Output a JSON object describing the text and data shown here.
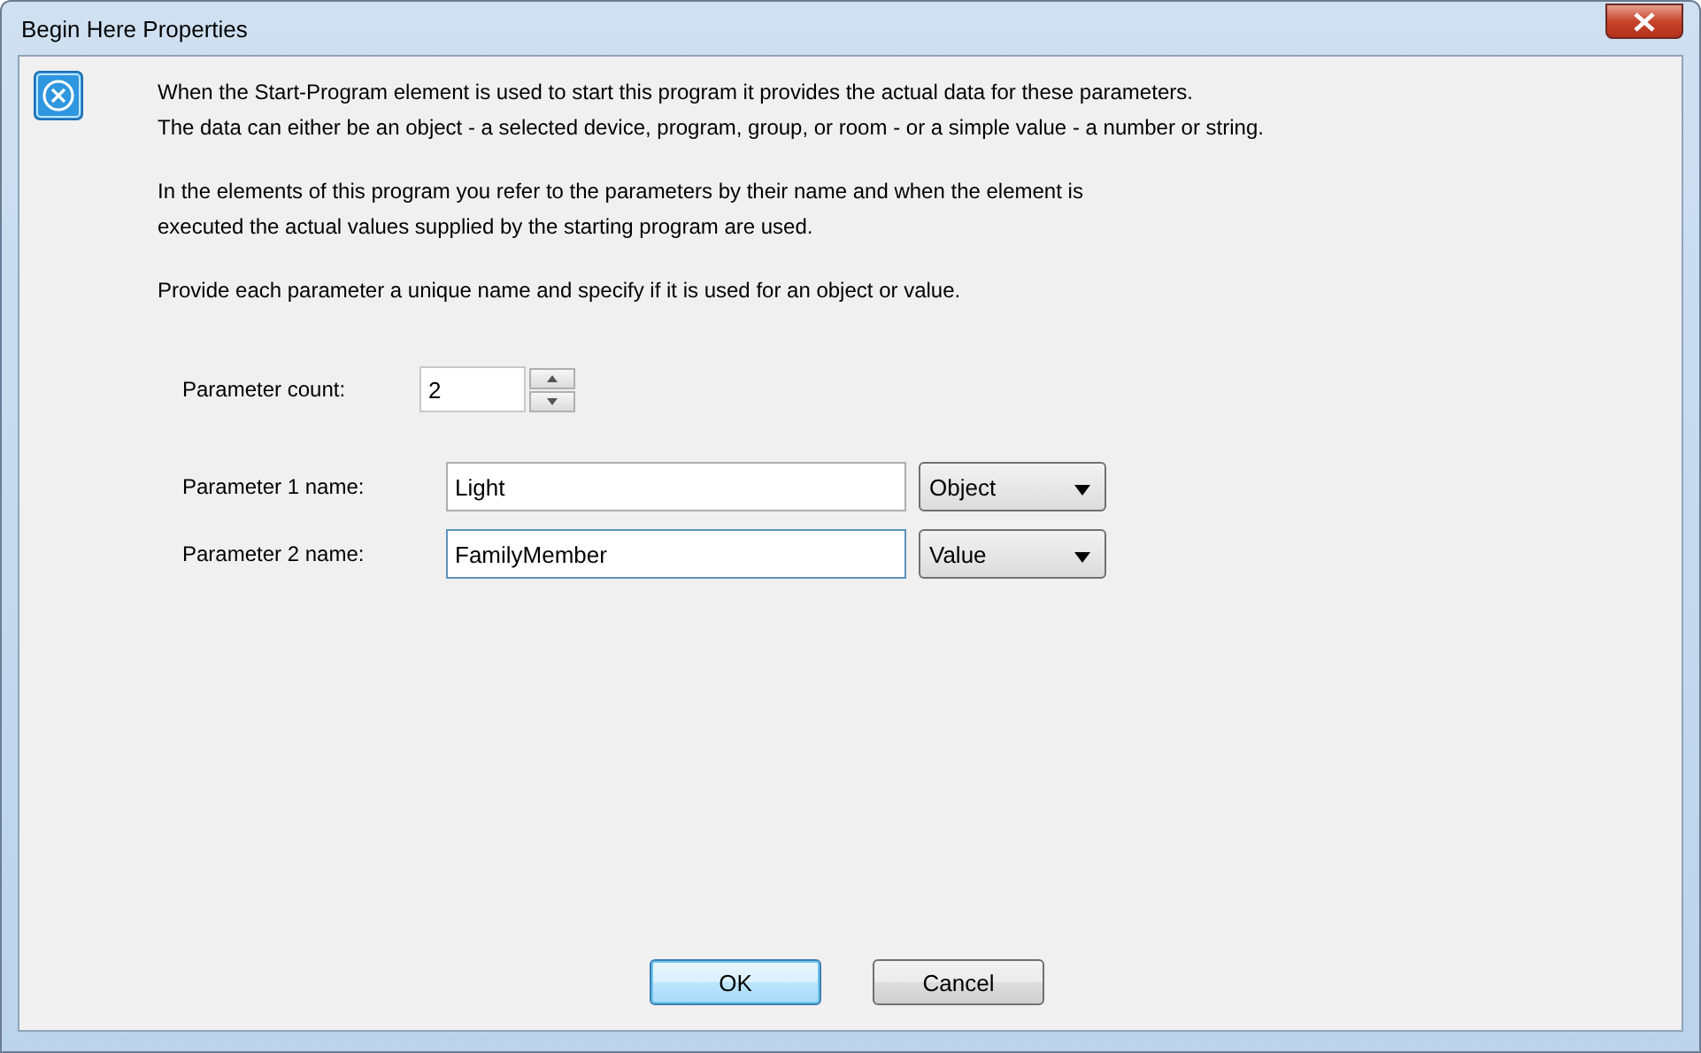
{
  "window": {
    "title": "Begin Here Properties"
  },
  "intro": [
    "When the Start-Program element is used to start this program it provides the actual data for these parameters.\nThe data can either be an object - a selected device, program, group, or room - or a simple value - a number or string.",
    "In the elements of this program you refer to the parameters by their name and when the element is\nexecuted the actual values supplied by the starting program are used.",
    "Provide each parameter a unique name and specify if it is used for an object or value."
  ],
  "count": {
    "label": "Parameter count:",
    "value": "2"
  },
  "parameters": [
    {
      "label": "Parameter 1 name:",
      "value": "Light",
      "focused": false,
      "type": "Object"
    },
    {
      "label": "Parameter 2 name:",
      "value": "FamilyMember",
      "focused": true,
      "type": "Value"
    }
  ],
  "buttons": [
    {
      "label": "OK",
      "default": true
    },
    {
      "label": "Cancel",
      "default": false
    }
  ]
}
